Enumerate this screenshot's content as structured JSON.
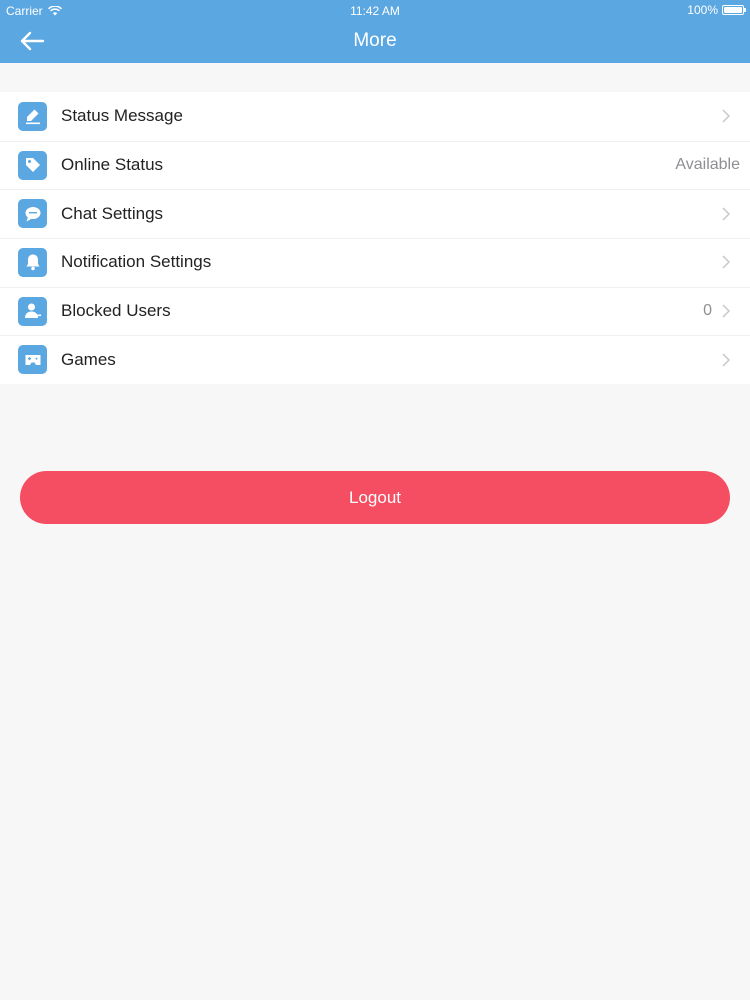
{
  "status_bar": {
    "carrier": "Carrier",
    "time": "11:42 AM",
    "battery": "100%"
  },
  "nav": {
    "title": "More",
    "back_icon": "arrow-left-icon"
  },
  "colors": {
    "header": "#5ba7e1",
    "icon_bg": "#5ba7e1",
    "logout": "#f54e62",
    "background": "#f7f7f7"
  },
  "menu": {
    "items": [
      {
        "label": "Status Message",
        "value": "",
        "icon": "pencil-icon"
      },
      {
        "label": "Online Status",
        "value": "Available",
        "icon": "tag-icon"
      },
      {
        "label": "Chat Settings",
        "value": "",
        "icon": "chat-bubble-icon"
      },
      {
        "label": "Notification Settings",
        "value": "",
        "icon": "bell-icon"
      },
      {
        "label": "Blocked Users",
        "value": "0",
        "icon": "user-blocked-icon"
      },
      {
        "label": "Games",
        "value": "",
        "icon": "gamepad-icon"
      }
    ]
  },
  "logout": {
    "label": "Logout"
  }
}
